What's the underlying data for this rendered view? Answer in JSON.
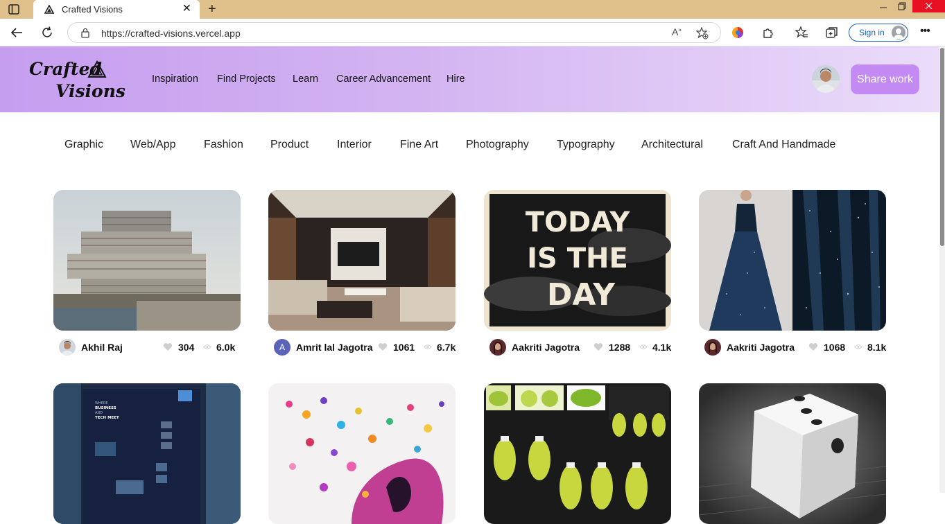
{
  "browser": {
    "tab_title": "Crafted Visions",
    "url": "https://crafted-visions.vercel.app",
    "signin_label": "Sign in"
  },
  "site": {
    "logo_line1": "Crafted",
    "logo_line2": "Visions",
    "nav": [
      "Inspiration",
      "Find Projects",
      "Learn",
      "Career Advancement",
      "Hire"
    ],
    "share_button": "Share work",
    "accent_color": "#c48af4"
  },
  "categories": [
    "Graphic",
    "Web/App",
    "Fashion",
    "Product",
    "Interior",
    "Fine Art",
    "Photography",
    "Typography",
    "Architectural",
    "Craft And Handmade"
  ],
  "projects": [
    {
      "author": "Akhil Raj",
      "likes": "304",
      "views": "6.0k",
      "thumbnail": "modern-office-building",
      "avatar": "photo"
    },
    {
      "author": "Amrit lal Jagotra",
      "likes": "1061",
      "views": "6.7k",
      "thumbnail": "living-room-interior",
      "avatar": "letter",
      "avatar_letter": "A"
    },
    {
      "author": "Aakriti Jagotra",
      "likes": "1288",
      "views": "4.1k",
      "thumbnail": "today-is-the-day-typography",
      "thumbnail_text": [
        "TODAY",
        "IS THE",
        "DAY"
      ],
      "avatar": "photo"
    },
    {
      "author": "Aakriti Jagotra",
      "likes": "1068",
      "views": "8.1k",
      "thumbnail": "starry-evening-gown",
      "avatar": "photo"
    },
    {
      "thumbnail": "business-tech-meet-website",
      "thumbnail_text": [
        "WHERE",
        "BUSINESS",
        "AND",
        "TECH MEET"
      ]
    },
    {
      "thumbnail": "butterfly-art"
    },
    {
      "thumbnail": "lime-bottle-product"
    },
    {
      "thumbnail": "dice-photograph"
    }
  ]
}
